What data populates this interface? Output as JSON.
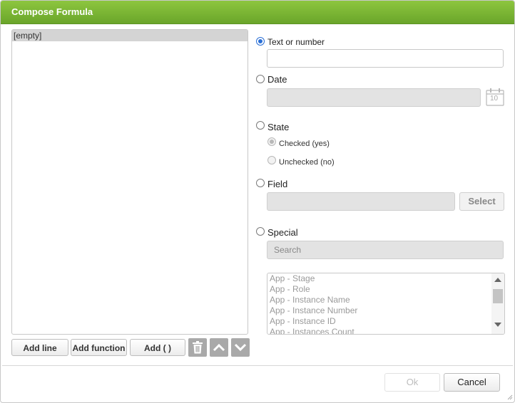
{
  "dialog": {
    "title": "Compose Formula"
  },
  "formula_list": {
    "items": [
      "[empty]"
    ]
  },
  "left_buttons": {
    "add_line": "Add line",
    "add_function": "Add function",
    "add_parens": "Add ( )"
  },
  "options": {
    "text_or_number": {
      "label": "Text or number",
      "selected": true,
      "value": ""
    },
    "date": {
      "label": "Date",
      "selected": false,
      "value": "",
      "calendar_day": "10"
    },
    "state": {
      "label": "State",
      "selected": false,
      "checked_label": "Checked (yes)",
      "unchecked_label": "Unchecked (no)",
      "state_value": "checked"
    },
    "field": {
      "label": "Field",
      "selected": false,
      "value": "",
      "select_label": "Select"
    },
    "special": {
      "label": "Special",
      "selected": false,
      "search_placeholder": "Search",
      "items": [
        "App - Stage",
        "App - Role",
        "App - Instance Name",
        "App - Instance Number",
        "App - Instance ID",
        "App - Instances Count"
      ]
    }
  },
  "footer": {
    "ok_label": "Ok",
    "cancel_label": "Cancel"
  },
  "colors": {
    "titlebar": "#7ab535",
    "radio_accent": "#2a6fd6",
    "icon_button": "#a9a9a9"
  }
}
